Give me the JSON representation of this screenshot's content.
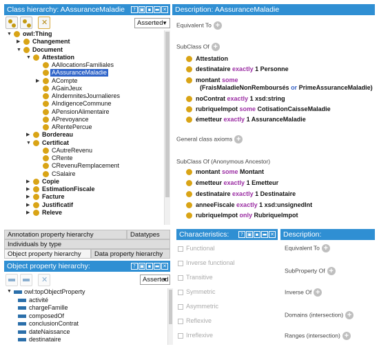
{
  "class_panel": {
    "title": "Class hierarchy: AAssuranceMaladie",
    "asserted": "Asserted",
    "tree": [
      {
        "label": "owl:Thing",
        "toggle": "▼"
      },
      {
        "label": "Changement",
        "toggle": "▶"
      },
      {
        "label": "Document",
        "toggle": "▼"
      },
      {
        "label": "Attestation",
        "toggle": "▼"
      },
      {
        "label": "AAllocationsFamiliales",
        "toggle": ""
      },
      {
        "label": "AAssuranceMaladie",
        "toggle": ""
      },
      {
        "label": "ACompte",
        "toggle": "▶"
      },
      {
        "label": "AGainJeux",
        "toggle": ""
      },
      {
        "label": "AIndemnitesJournalieres",
        "toggle": ""
      },
      {
        "label": "AIndigenceCommune",
        "toggle": ""
      },
      {
        "label": "APensionAlimentaire",
        "toggle": ""
      },
      {
        "label": "APrevoyance",
        "toggle": ""
      },
      {
        "label": "ARentePercue",
        "toggle": ""
      },
      {
        "label": "Bordereau",
        "toggle": "▶"
      },
      {
        "label": "Certificat",
        "toggle": "▼"
      },
      {
        "label": "CAutreRevenu",
        "toggle": ""
      },
      {
        "label": "CRente",
        "toggle": ""
      },
      {
        "label": "CRevenuRemplacement",
        "toggle": ""
      },
      {
        "label": "CSalaire",
        "toggle": ""
      },
      {
        "label": "Copie",
        "toggle": "▶"
      },
      {
        "label": "EstimationFiscale",
        "toggle": "▶"
      },
      {
        "label": "Facture",
        "toggle": "▶"
      },
      {
        "label": "Justificatif",
        "toggle": "▶"
      },
      {
        "label": "Releve",
        "toggle": "▶"
      }
    ]
  },
  "desc_panel": {
    "title": "Description: AAssuranceMaladie",
    "equivalent_to": "Equivalent To",
    "subclass_of": "SubClass Of",
    "general_axioms": "General class axioms",
    "subclass_anc": "SubClass Of (Anonymous Ancestor)",
    "subclass_items": {
      "i0": "Attestation",
      "i1a": "destinataire",
      "i1k": "exactly",
      "i1b": "1 Personne",
      "i2a": "montant",
      "i2k": "some",
      "i2c": "(FraisMaladieNonRemboursés",
      "i2or": "or",
      "i2d": "PrimeAssuranceMaladie)",
      "i3a": "noContrat",
      "i3k": "exactly",
      "i3b": "1 xsd:string",
      "i4a": "rubriqueImpot",
      "i4k": "some",
      "i4b": "CotisationCaisseMaladie",
      "i5a": "émetteur",
      "i5k": "exactly",
      "i5b": "1 AssuranceMaladie"
    },
    "anc_items": {
      "a0a": "montant",
      "a0k": "some",
      "a0b": "Montant",
      "a1a": "émetteur",
      "a1k": "exactly",
      "a1b": "1 Emetteur",
      "a2a": "destinataire",
      "a2k": "exactly",
      "a2b": "1 Destinataire",
      "a3a": "anneeFiscale",
      "a3k": "exactly",
      "a3b": "1 xsd:unsignedInt",
      "a4a": "rubriqueImpot",
      "a4k": "only",
      "a4b": "RubriqueImpot"
    }
  },
  "tabs": {
    "annotation": "Annotation property hierarchy",
    "datatypes": "Datatypes",
    "individuals": "Individuals by type",
    "object_prop": "Object property hierarchy",
    "data_prop": "Data property hierarchy"
  },
  "obj_panel": {
    "title": "Object property hierarchy:",
    "asserted": "Asserted",
    "items": [
      "owl:topObjectProperty",
      "activité",
      "chargeFamille",
      "composedOf",
      "conclusionContrat",
      "dateNaissance",
      "destinataire"
    ]
  },
  "char_panel": {
    "title": "Characteristics:",
    "items": [
      "Functional",
      "Inverse functional",
      "Transitive",
      "Symmetric",
      "Asymmetric",
      "Reflexive",
      "Irreflexive"
    ]
  },
  "desc2_panel": {
    "title": "Description:",
    "items": [
      "Equivalent To",
      "SubProperty Of",
      "Inverse Of",
      "Domains (intersection)",
      "Ranges (intersection)"
    ]
  },
  "header_icons": [
    "?",
    "▣",
    "▪",
    "▬",
    "✕"
  ],
  "colors": {
    "header": "#2f8fd3",
    "class_dot": "#d9a416",
    "keyword": "#9b2ea3",
    "or_keyword": "#3a64c5",
    "selected": "#2f64c9"
  }
}
